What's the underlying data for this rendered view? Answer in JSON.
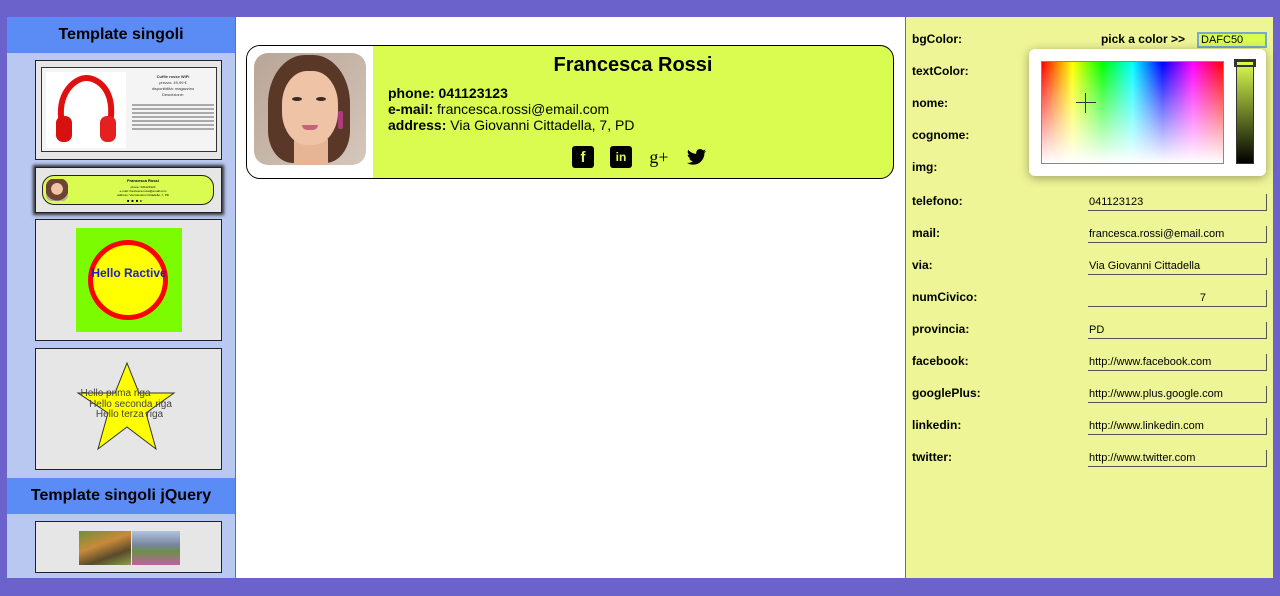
{
  "sidebar": {
    "section1_title": "Template singoli",
    "section2_title": "Template singoli jQuery",
    "thumb_product": {
      "title": "Cuffie rosse WiFi",
      "line1": "prezzo: 49,99 €",
      "line2": "disponibilità: magazzino",
      "line3": "Descrizione:"
    },
    "thumb_card": {
      "name": "Francesca Rossi",
      "line1": "phone: 041123123",
      "line2": "e-mail: francesca.rossi@email.com",
      "line3": "address: Via Giovanni Cittadella, 7, PD"
    },
    "thumb_circle_text": "Hello Ractive",
    "thumb_star_lines": [
      "Hello prima riga",
      "Hello seconda riga",
      "Hello terza riga"
    ]
  },
  "card": {
    "name": "Francesca Rossi",
    "phone_label": "phone:",
    "phone": "041123123",
    "email_label": "e-mail:",
    "email": "francesca.rossi@email.com",
    "address_label": "address:",
    "address": "Via Giovanni Cittadella, 7, PD",
    "bg_color": "#dafc50",
    "socials": [
      "facebook-icon",
      "linkedin-icon",
      "googleplus-icon",
      "twitter-icon"
    ]
  },
  "editor": {
    "pick_label": "pick a color >>",
    "bgColor_value": "DAFC50",
    "fields": [
      {
        "label": "bgColor:",
        "value": ""
      },
      {
        "label": "textColor:",
        "value": ""
      },
      {
        "label": "nome:",
        "value": ""
      },
      {
        "label": "cognome:",
        "value": ""
      },
      {
        "label": "img:",
        "value": ""
      },
      {
        "label": "telefono:",
        "value": "041123123"
      },
      {
        "label": "mail:",
        "value": "francesca.rossi@email.com"
      },
      {
        "label": "via:",
        "value": "Via Giovanni Cittadella"
      },
      {
        "label": "numCivico:",
        "value": "7"
      },
      {
        "label": "provincia:",
        "value": "PD"
      },
      {
        "label": "facebook:",
        "value": "http://www.facebook.com"
      },
      {
        "label": "googlePlus:",
        "value": "http://www.plus.google.com"
      },
      {
        "label": "linkedin:",
        "value": "http://www.linkedin.com"
      },
      {
        "label": "twitter:",
        "value": "http://www.twitter.com"
      }
    ]
  }
}
